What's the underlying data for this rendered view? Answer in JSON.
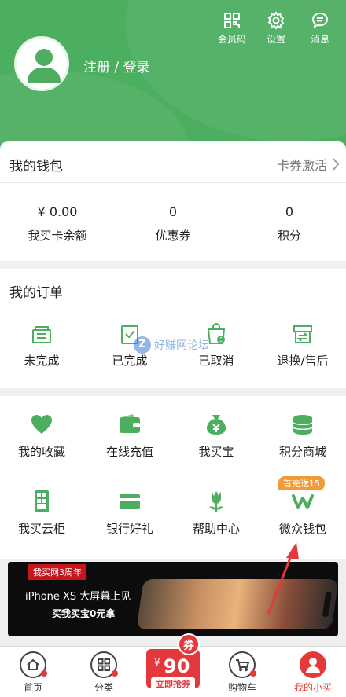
{
  "header": {
    "login_label": "注册 / 登录",
    "actions": [
      {
        "label": "会员码",
        "icon": "qr-code-icon"
      },
      {
        "label": "设置",
        "icon": "gear-icon"
      },
      {
        "label": "消息",
        "icon": "message-icon"
      }
    ]
  },
  "wallet": {
    "title": "我的钱包",
    "action_label": "卡券激活",
    "stats": [
      {
        "value": "¥ 0.00",
        "label": "我买卡余额"
      },
      {
        "value": "0",
        "label": "优惠券"
      },
      {
        "value": "0",
        "label": "积分"
      }
    ]
  },
  "orders": {
    "title": "我的订单",
    "items": [
      {
        "label": "未完成",
        "icon": "wallet-stack-icon"
      },
      {
        "label": "已完成",
        "icon": "clipboard-check-icon"
      },
      {
        "label": "已取消",
        "icon": "bag-cancel-icon"
      },
      {
        "label": "退换/售后",
        "icon": "return-box-icon"
      }
    ]
  },
  "watermark": "好赚网论坛",
  "services": {
    "row1": [
      {
        "label": "我的收藏",
        "icon": "heart-icon"
      },
      {
        "label": "在线充值",
        "icon": "wallet-icon"
      },
      {
        "label": "我买宝",
        "icon": "money-bag-icon"
      },
      {
        "label": "积分商城",
        "icon": "coin-stack-icon"
      }
    ],
    "row2": [
      {
        "label": "我买云柜",
        "icon": "locker-icon"
      },
      {
        "label": "银行好礼",
        "icon": "bank-card-icon"
      },
      {
        "label": "帮助中心",
        "icon": "tulip-icon"
      },
      {
        "label": "微众钱包",
        "icon": "webank-icon"
      }
    ],
    "badge": "首充送15"
  },
  "banner": {
    "tag": "我买网3周年",
    "line1": "iPhone XS 大屏幕上见",
    "line2": "买我买宝0元拿"
  },
  "tabbar": {
    "items": [
      {
        "label": "首页",
        "icon": "home-icon"
      },
      {
        "label": "分类",
        "icon": "grid-icon"
      },
      {
        "label": "购物车",
        "icon": "cart-icon"
      },
      {
        "label": "我的小买",
        "icon": "profile-icon"
      }
    ],
    "coupon": {
      "amount": "90",
      "currency": "¥",
      "tag": "券",
      "cta": "立即抢券"
    }
  },
  "colors": {
    "brand_green": "#4cae5f",
    "accent_red": "#e4393c",
    "badge_orange": "#f19a36"
  }
}
